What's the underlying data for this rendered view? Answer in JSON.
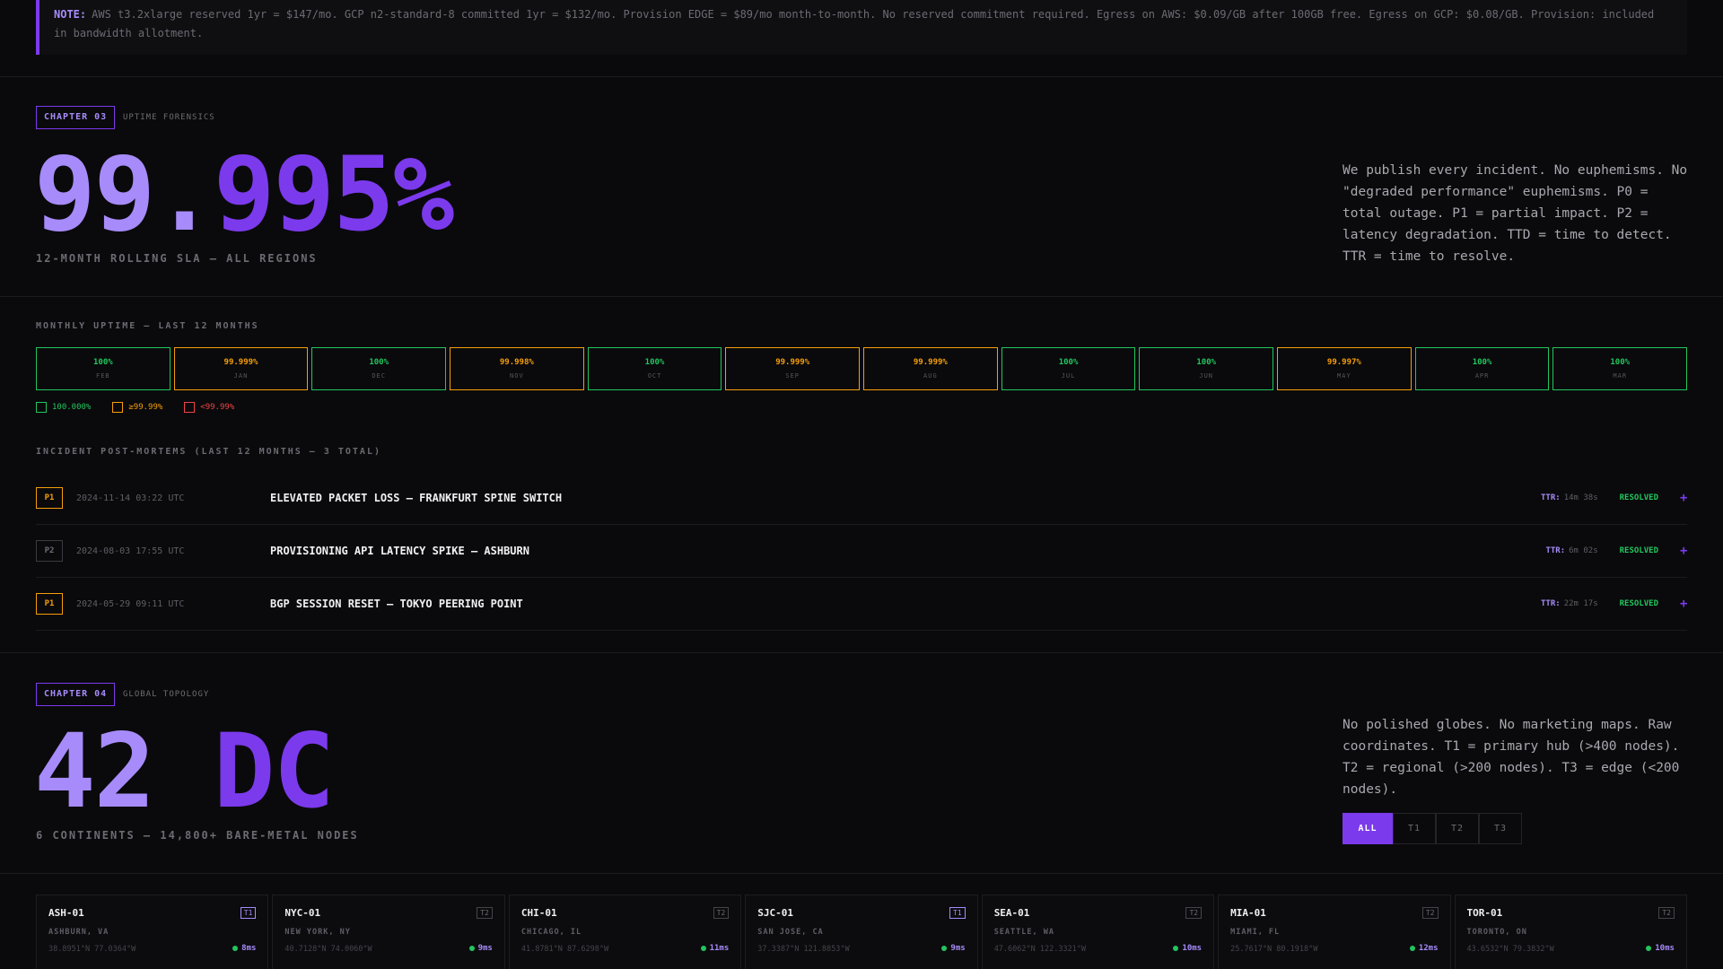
{
  "note": {
    "label": "NOTE:",
    "text": "AWS t3.2xlarge reserved 1yr = $147/mo. GCP n2-standard-8 committed 1yr = $132/mo. Provision EDGE = $89/mo month-to-month. No reserved commitment required. Egress on AWS: $0.09/GB after 100GB free. Egress on GCP: $0.08/GB. Provision: included in bandwidth allotment."
  },
  "chapter3": {
    "tag": "CHAPTER 03",
    "subtitle": "UPTIME FORENSICS",
    "big_a": "99.",
    "big_b": "995%",
    "caption": "12-MONTH ROLLING SLA — ALL REGIONS",
    "description": "We publish every incident. No euphemisms. No \"degraded performance\" euphemisms. P0 = total outage. P1 = partial impact. P2 = latency degradation. TTD = time to detect. TTR = time to resolve."
  },
  "monthly": {
    "label": "MONTHLY UPTIME — LAST 12 MONTHS",
    "months": [
      {
        "value": "100%",
        "month": "FEB",
        "status": "green"
      },
      {
        "value": "99.999%",
        "month": "JAN",
        "status": "orange"
      },
      {
        "value": "100%",
        "month": "DEC",
        "status": "green"
      },
      {
        "value": "99.998%",
        "month": "NOV",
        "status": "orange"
      },
      {
        "value": "100%",
        "month": "OCT",
        "status": "green"
      },
      {
        "value": "99.999%",
        "month": "SEP",
        "status": "orange"
      },
      {
        "value": "99.999%",
        "month": "AUG",
        "status": "orange"
      },
      {
        "value": "100%",
        "month": "JUL",
        "status": "green"
      },
      {
        "value": "100%",
        "month": "JUN",
        "status": "green"
      },
      {
        "value": "99.997%",
        "month": "MAY",
        "status": "orange"
      },
      {
        "value": "100%",
        "month": "APR",
        "status": "green"
      },
      {
        "value": "100%",
        "month": "MAR",
        "status": "green"
      }
    ],
    "legend": [
      {
        "label": "100.000%",
        "color": "#22c55e"
      },
      {
        "label": "≥99.99%",
        "color": "#f59e0b"
      },
      {
        "label": "<99.99%",
        "color": "#ef4444"
      }
    ]
  },
  "incidents": {
    "label": "INCIDENT POST-MORTEMS (LAST 12 MONTHS — 3 TOTAL)",
    "items": [
      {
        "priority": "P1",
        "date": "2024-11-14 03:22 UTC",
        "title": "ELEVATED PACKET LOSS — FRANKFURT SPINE SWITCH",
        "ttr_label": "TTR:",
        "ttr": "14m 38s",
        "status": "RESOLVED",
        "expand": "+"
      },
      {
        "priority": "P2",
        "date": "2024-08-03 17:55 UTC",
        "title": "PROVISIONING API LATENCY SPIKE — ASHBURN",
        "ttr_label": "TTR:",
        "ttr": "6m 02s",
        "status": "RESOLVED",
        "expand": "+"
      },
      {
        "priority": "P1",
        "date": "2024-05-29 09:11 UTC",
        "title": "BGP SESSION RESET — TOKYO PEERING POINT",
        "ttr_label": "TTR:",
        "ttr": "22m 17s",
        "status": "RESOLVED",
        "expand": "+"
      }
    ]
  },
  "chapter4": {
    "tag": "CHAPTER 04",
    "subtitle": "GLOBAL TOPOLOGY",
    "big_a": "42 ",
    "big_b": "DC",
    "caption": "6 CONTINENTS — 14,800+ BARE-METAL NODES",
    "description": "No polished globes. No marketing maps. Raw coordinates. T1 = primary hub (>400 nodes). T2 = regional (>200 nodes). T3 = edge (<200 nodes).",
    "filters": [
      "ALL",
      "T1",
      "T2",
      "T3"
    ]
  },
  "datacenters": [
    {
      "code": "ASH-01",
      "tier": "T1",
      "city": "ASHBURN, VA",
      "coords": "38.8951°N 77.0364°W",
      "latency": "8ms"
    },
    {
      "code": "NYC-01",
      "tier": "T2",
      "city": "NEW YORK, NY",
      "coords": "40.7128°N 74.0060°W",
      "latency": "9ms"
    },
    {
      "code": "CHI-01",
      "tier": "T2",
      "city": "CHICAGO, IL",
      "coords": "41.8781°N 87.6298°W",
      "latency": "11ms"
    },
    {
      "code": "SJC-01",
      "tier": "T1",
      "city": "SAN JOSE, CA",
      "coords": "37.3387°N 121.8853°W",
      "latency": "9ms"
    },
    {
      "code": "SEA-01",
      "tier": "T2",
      "city": "SEATTLE, WA",
      "coords": "47.6062°N 122.3321°W",
      "latency": "10ms"
    },
    {
      "code": "MIA-01",
      "tier": "T2",
      "city": "MIAMI, FL",
      "coords": "25.7617°N 80.1918°W",
      "latency": "12ms"
    },
    {
      "code": "TOR-01",
      "tier": "T2",
      "city": "TORONTO, ON",
      "coords": "43.6532°N 79.3832°W",
      "latency": "10ms"
    }
  ]
}
